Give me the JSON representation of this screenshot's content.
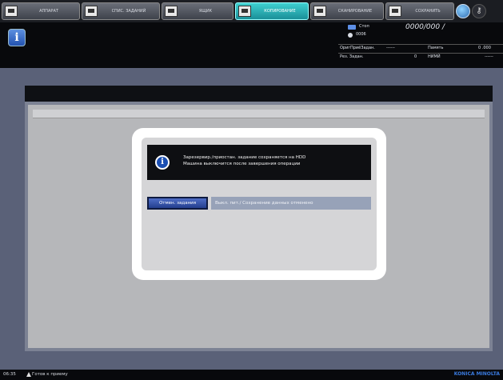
{
  "tabs": [
    {
      "label": "АППАРАТ",
      "icon": "machine-icon",
      "active": false
    },
    {
      "label": "СПИС. ЗАДАНИЙ",
      "icon": "job-list-icon",
      "active": false
    },
    {
      "label": "ЯЩИК",
      "icon": "box-icon",
      "active": false
    },
    {
      "label": "КОПИРОВАНИЕ",
      "icon": "copy-icon",
      "active": true
    },
    {
      "label": "СКАНИРОВАНИЕ",
      "icon": "scan-icon",
      "active": false
    },
    {
      "label": "СОХРАНИТЬ",
      "icon": "save-icon",
      "active": false
    }
  ],
  "status": {
    "stop_label": "Стоп",
    "counter": "0000/000 /",
    "job_number": "0006",
    "row1_label": "ОригПриёЗадан.",
    "row1_value": "------",
    "memory_label": "Память",
    "memory_value": "0 .000",
    "row2_label": "Рез. Задан.",
    "row2_value": "0",
    "row3_label": "НИМЙ",
    "row3_value": "------"
  },
  "dialog": {
    "message_line1": "Зарезервир./приостан. задание сохраняется на HDD",
    "message_line2": "Машина выключится после завершения операции",
    "cancel_button": "Отмен. задания",
    "result_text": "Выкл. пит./ Сохранение данных отменено"
  },
  "footer": {
    "time": "06:35",
    "status": "Готов к приему",
    "brand": "KONICA MINOLTA"
  },
  "colors": {
    "active_tab": "#2bb0b8",
    "work_background": "#5a6178",
    "cancel_button": "#3452a8"
  }
}
